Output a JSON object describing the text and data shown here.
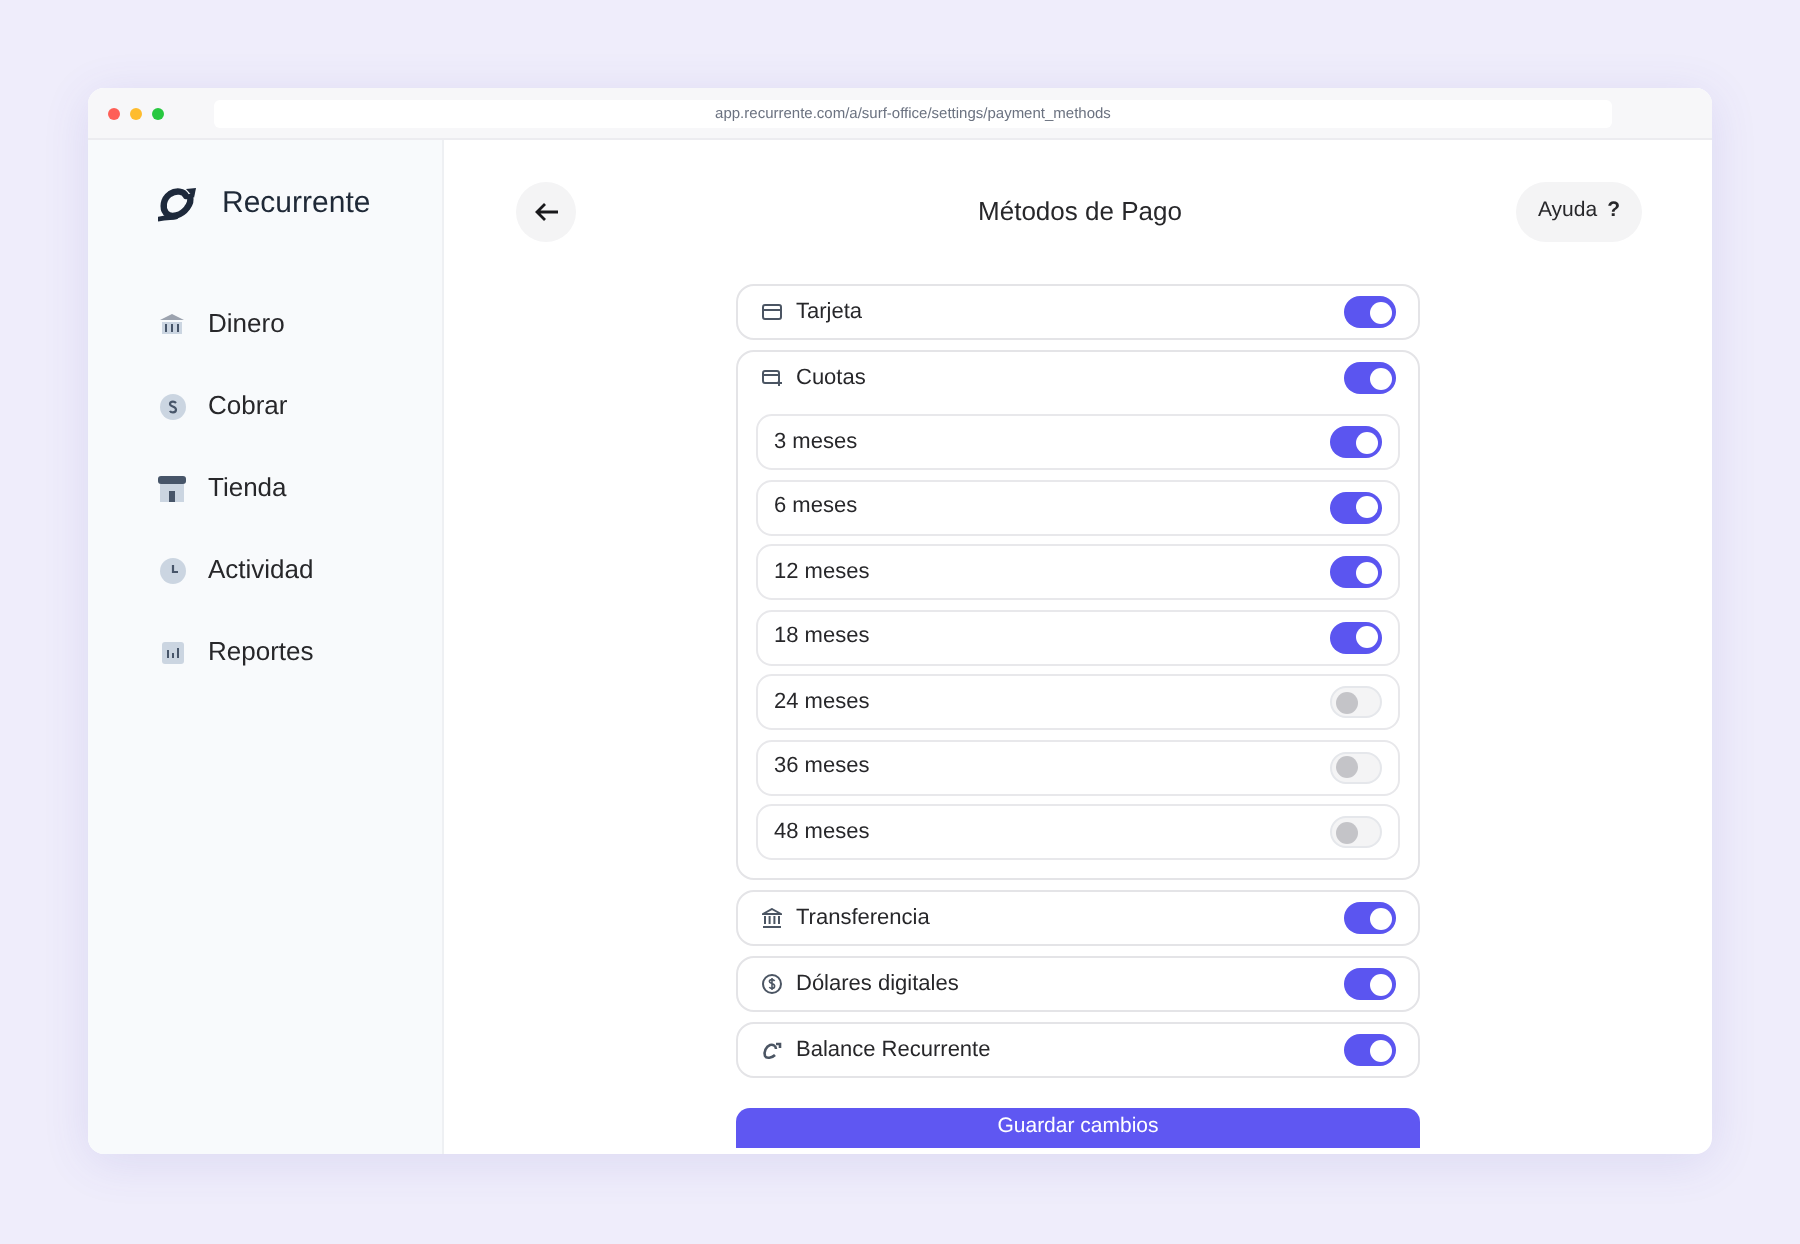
{
  "browser": {
    "url": "app.recurrente.com/a/surf-office/settings/payment_methods"
  },
  "sidebar": {
    "brand": "Recurrente",
    "items": [
      {
        "label": "Dinero"
      },
      {
        "label": "Cobrar"
      },
      {
        "label": "Tienda"
      },
      {
        "label": "Actividad"
      },
      {
        "label": "Reportes"
      }
    ]
  },
  "header": {
    "title": "Métodos de Pago",
    "help": {
      "label": "Ayuda",
      "mark": "?"
    }
  },
  "methods": [
    {
      "kind": "toggle",
      "label": "Tarjeta",
      "on": true
    },
    {
      "kind": "group",
      "label": "Cuotas",
      "on": true,
      "children": [
        {
          "label": "3 meses",
          "on": true
        },
        {
          "label": "6 meses",
          "on": true
        },
        {
          "label": "12 meses",
          "on": true
        },
        {
          "label": "18 meses",
          "on": true
        },
        {
          "label": "24 meses",
          "on": false
        },
        {
          "label": "36 meses",
          "on": false
        },
        {
          "label": "48 meses",
          "on": false
        }
      ]
    },
    {
      "kind": "toggle",
      "label": "Transferencia",
      "on": true
    },
    {
      "kind": "toggle",
      "label": "Dólares digitales",
      "on": true
    },
    {
      "kind": "toggle",
      "label": "Balance Recurrente",
      "on": true
    }
  ],
  "save_button": "Guardar cambios"
}
